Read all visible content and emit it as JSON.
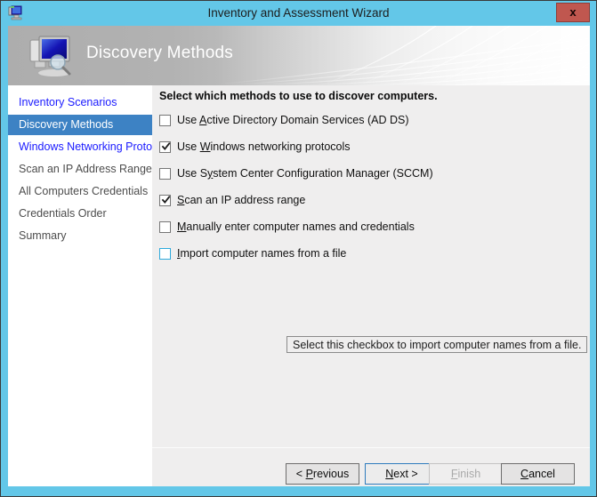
{
  "window": {
    "title": "Inventory and Assessment Wizard",
    "icon": "computer-icon",
    "close_label": "x",
    "accent_color": "#63c7e8",
    "close_color": "#c0574f"
  },
  "banner": {
    "title": "Discovery Methods",
    "icon": "computer-search-icon"
  },
  "sidebar": {
    "items": [
      {
        "label": "Inventory Scenarios",
        "state": "link"
      },
      {
        "label": "Discovery Methods",
        "state": "selected"
      },
      {
        "label": "Windows Networking Protocols",
        "state": "link"
      },
      {
        "label": "Scan an IP Address Range",
        "state": "dim"
      },
      {
        "label": "All Computers Credentials",
        "state": "dim"
      },
      {
        "label": "Credentials Order",
        "state": "dim"
      },
      {
        "label": "Summary",
        "state": "dim"
      }
    ],
    "selected_color": "#3d82c4",
    "link_color": "#1a1aff"
  },
  "main": {
    "heading": "Select which methods to use to discover computers.",
    "checkboxes": [
      {
        "pre": "Use ",
        "accel": "A",
        "post": "ctive Directory Domain Services (AD DS)",
        "checked": false,
        "focused": false
      },
      {
        "pre": "Use ",
        "accel": "W",
        "post": "indows networking protocols",
        "checked": true,
        "focused": false
      },
      {
        "pre": "Use S",
        "accel": "y",
        "post": "stem Center Configuration Manager (SCCM)",
        "checked": false,
        "focused": false
      },
      {
        "pre": "",
        "accel": "S",
        "post": "can an IP address range",
        "checked": true,
        "focused": false
      },
      {
        "pre": "",
        "accel": "M",
        "post": "anually enter computer names and credentials",
        "checked": false,
        "focused": false
      },
      {
        "pre": "",
        "accel": "I",
        "post": "mport computer names from a file",
        "checked": false,
        "focused": true
      }
    ],
    "tooltip": "Select this checkbox to import computer names from a file."
  },
  "footer": {
    "buttons": [
      {
        "name": "previous",
        "pre": "< ",
        "accel": "P",
        "post": "revious",
        "state": "normal"
      },
      {
        "name": "next",
        "pre": "",
        "accel": "N",
        "post": "ext >",
        "state": "default"
      },
      {
        "name": "finish",
        "pre": "",
        "accel": "F",
        "post": "inish",
        "state": "disabled"
      },
      {
        "name": "cancel",
        "pre": "",
        "accel": "C",
        "post": "ancel",
        "state": "normal"
      }
    ]
  }
}
